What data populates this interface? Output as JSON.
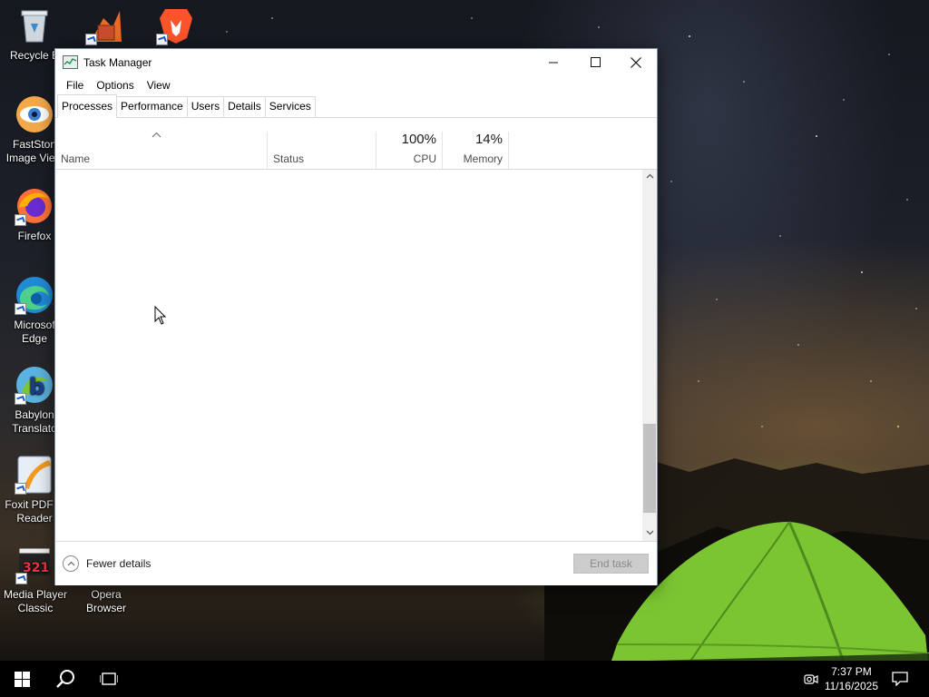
{
  "desktop": {
    "icons": [
      {
        "label": "Recycle B",
        "icon": "recycle-bin-icon"
      },
      {
        "label": "FastSton\nImage View",
        "icon": "faststone-icon"
      },
      {
        "label": "Firefox",
        "icon": "firefox-icon"
      },
      {
        "label": "Microsof\nEdge",
        "icon": "edge-icon"
      },
      {
        "label": "Babylon\nTranslato",
        "icon": "babylon-icon"
      },
      {
        "label": "Foxit PDF R\nReader",
        "icon": "foxit-icon"
      },
      {
        "label": "Media Player\nClassic",
        "icon": "media-player-classic-icon"
      },
      {
        "label": "",
        "icon": "installer-app-icon"
      },
      {
        "label": "",
        "icon": "brave-icon"
      },
      {
        "label": "Opera\nBrowser",
        "icon": "opera-icon"
      }
    ]
  },
  "window": {
    "title": "Task Manager",
    "menu": [
      "File",
      "Options",
      "View"
    ],
    "tabs": [
      "Processes",
      "Performance",
      "Users",
      "Details",
      "Services"
    ],
    "active_tab": "Processes",
    "columns": {
      "name": "Name",
      "status": "Status",
      "cpu_pct": "100%",
      "cpu": "CPU",
      "memory_pct": "14%",
      "memory": "Memory"
    },
    "footer": {
      "fewer_details": "Fewer details",
      "end_task": "End task"
    }
  },
  "taskbar": {
    "time": "7:37 PM",
    "date": "11/16/2025"
  },
  "colors": {
    "window_border": "#7f8fa6",
    "disabled_button": "#cccccc",
    "taskbar": "#000000"
  }
}
